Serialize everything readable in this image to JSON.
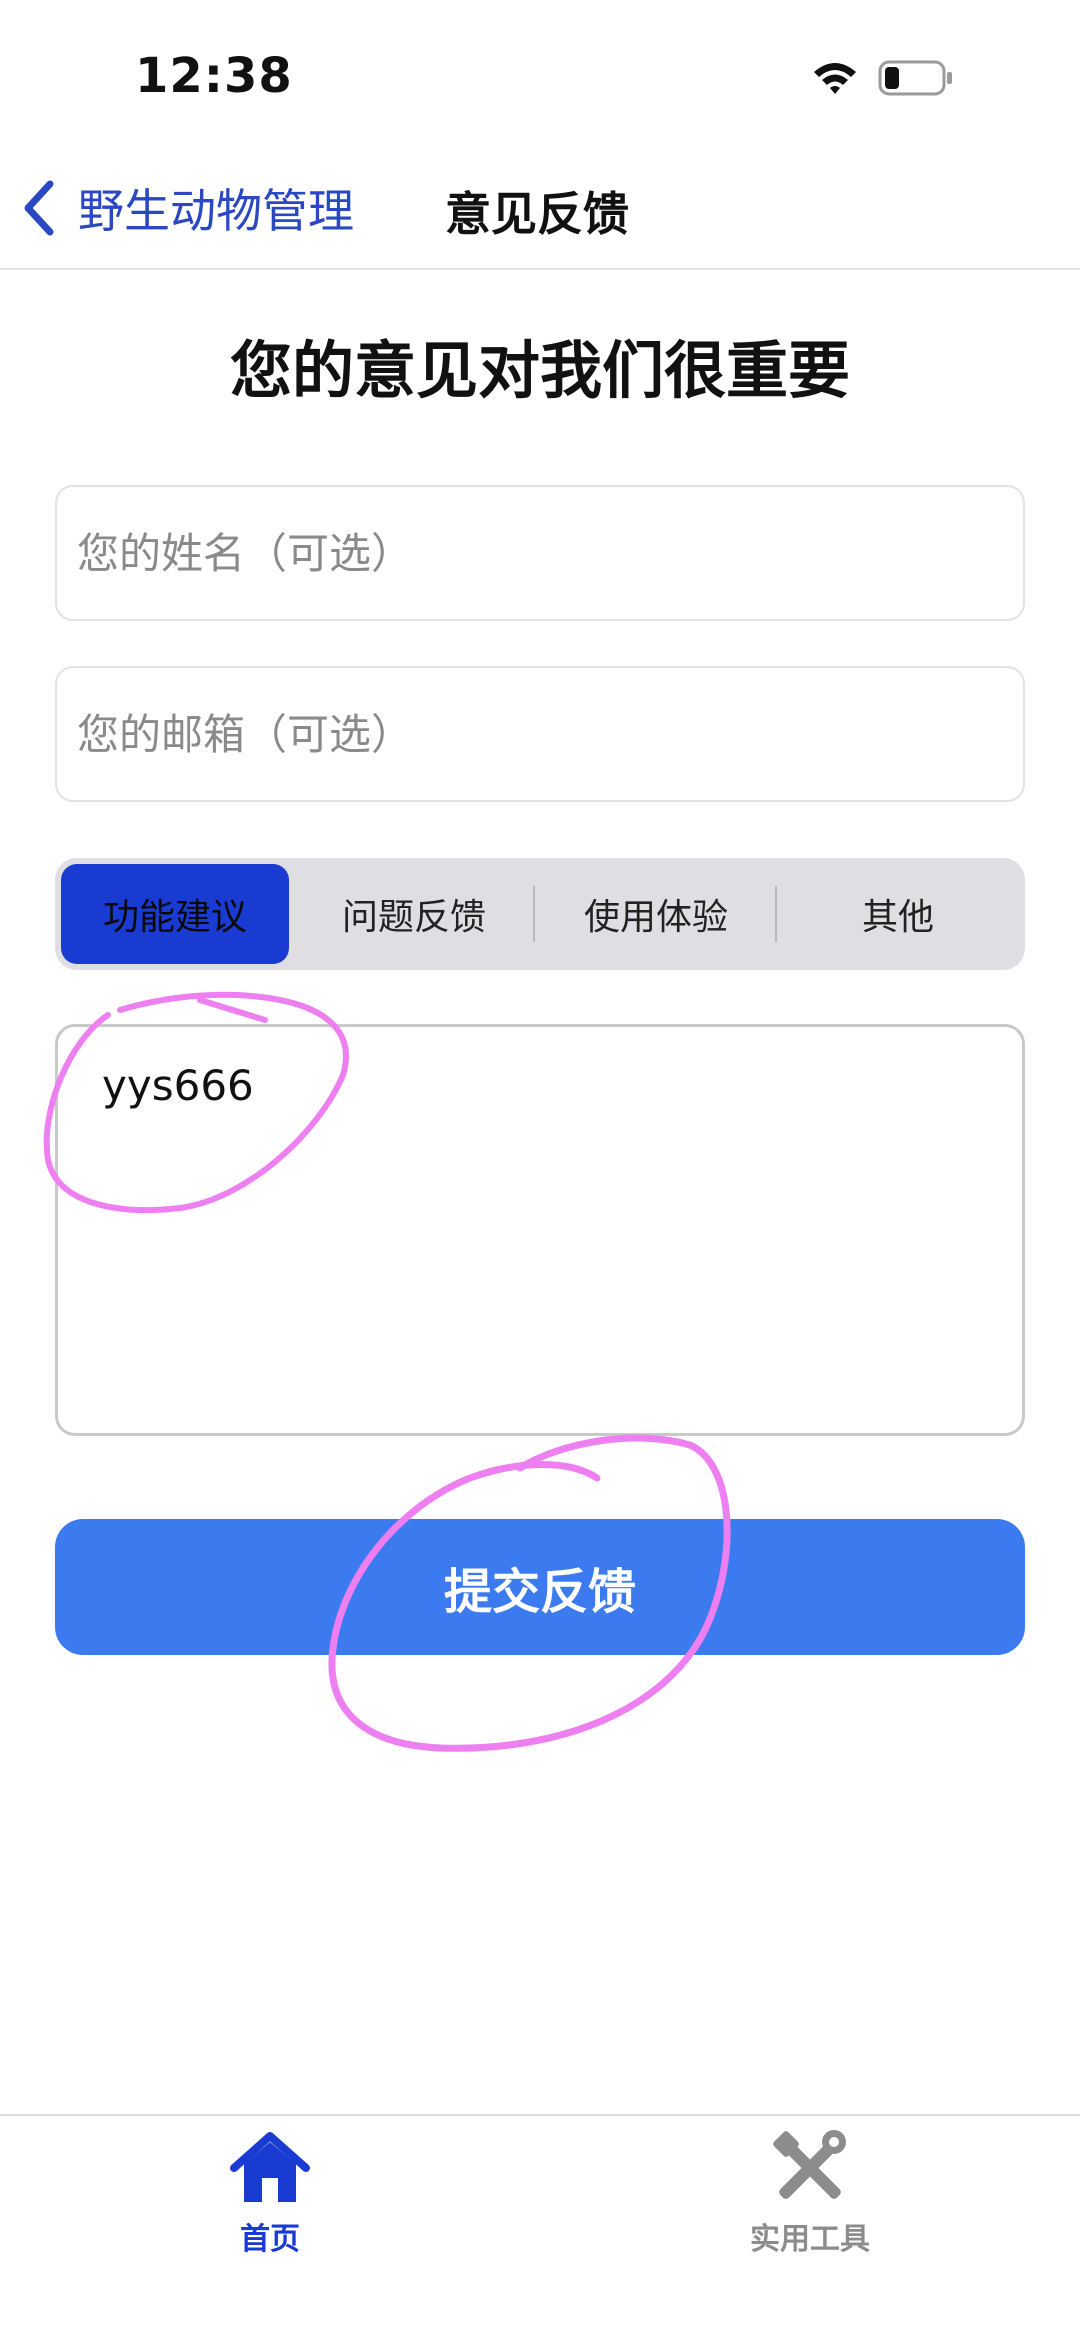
{
  "status_bar": {
    "time": "12:38",
    "icons": [
      "wifi-icon",
      "battery-icon"
    ]
  },
  "nav": {
    "back_label": "野生动物管理",
    "title": "意见反馈"
  },
  "page": {
    "heading": "您的意见对我们很重要"
  },
  "form": {
    "name_placeholder": "您的姓名（可选）",
    "name_value": "",
    "email_placeholder": "您的邮箱（可选）",
    "email_value": "",
    "categories": [
      {
        "label": "功能建议",
        "selected": true
      },
      {
        "label": "问题反馈",
        "selected": false
      },
      {
        "label": "使用体验",
        "selected": false
      },
      {
        "label": "其他",
        "selected": false
      }
    ],
    "feedback_value": "yys666",
    "submit_label": "提交反馈"
  },
  "tab_bar": {
    "items": [
      {
        "label": "首页",
        "icon": "home-icon",
        "active": true
      },
      {
        "label": "实用工具",
        "icon": "tools-icon",
        "active": false
      }
    ]
  },
  "colors": {
    "accent": "#1a3bd1",
    "link": "#2a48c2",
    "submit": "#3b7bef",
    "annotation": "#ee7ff0",
    "inactive_tab": "#8c8c8c"
  }
}
